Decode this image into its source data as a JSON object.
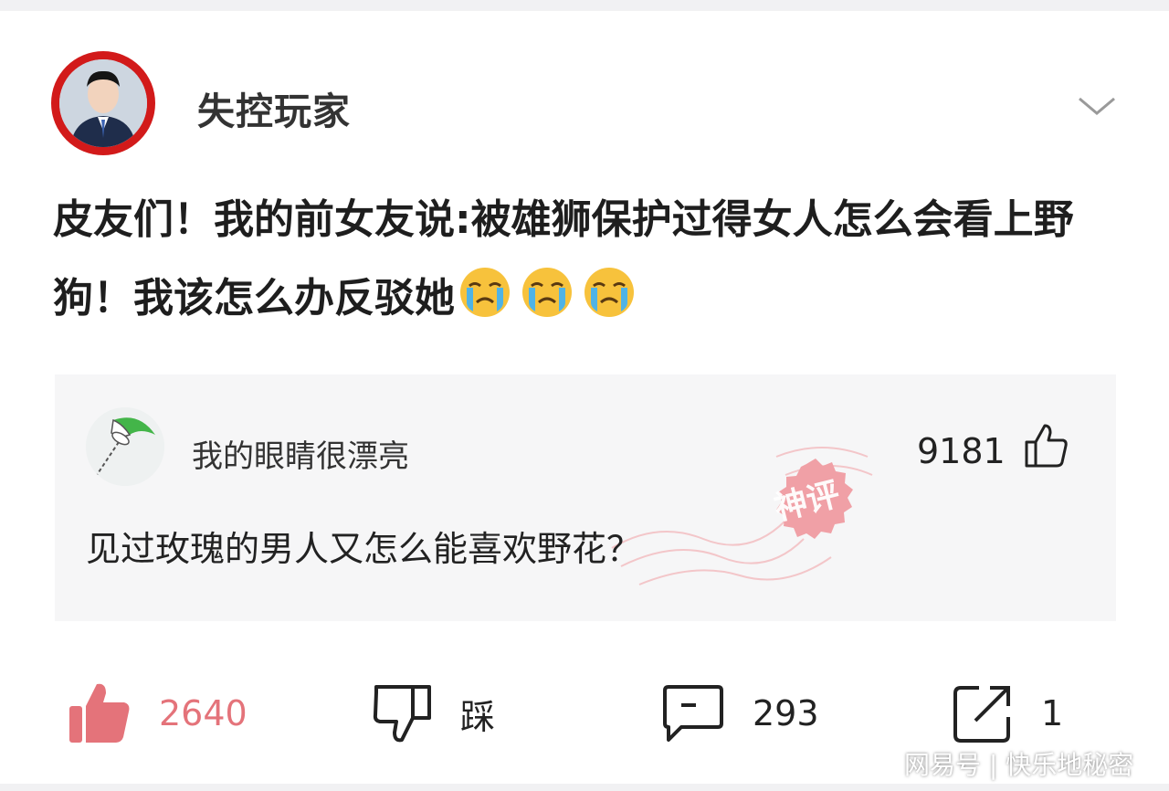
{
  "header": {
    "username": "失控玩家"
  },
  "post": {
    "text": "皮友们！我的前女友说:被雄狮保护过得女人怎么会看上野狗！我该怎么办反驳她",
    "emoji": [
      "loudly-crying-face",
      "loudly-crying-face",
      "loudly-crying-face"
    ]
  },
  "hot_comment": {
    "username": "我的眼睛很漂亮",
    "likes": "9181",
    "text": "见过玫瑰的男人又怎么能喜欢野花？",
    "badge": "神评"
  },
  "actions": {
    "like_count": "2640",
    "dislike_label": "踩",
    "comment_count": "293",
    "share_count": "1"
  },
  "watermark": "网易号 | 快乐地秘密",
  "colors": {
    "accent_like": "#e4737a",
    "avatar_ring": "#d21a1a",
    "badge": "#f0a0a6"
  }
}
